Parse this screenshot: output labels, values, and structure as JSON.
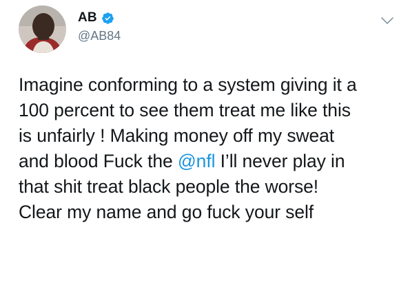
{
  "tweet": {
    "author": {
      "display_name": "AB",
      "handle": "@AB84",
      "verified": true,
      "avatar_icon": "profile-avatar-icon"
    },
    "menu_icon": "chevron-down-icon",
    "text_lines": [
      {
        "before": "Imagine conforming to a system giving it a",
        "mention": "",
        "after": ""
      },
      {
        "before": "100 percent to see them treat me like this",
        "mention": "",
        "after": ""
      },
      {
        "before": "is unfairly ! Making money off my sweat",
        "mention": "",
        "after": ""
      },
      {
        "before": "and blood Fuck the ",
        "mention": "@nfl",
        "after": " I’ll never play in"
      },
      {
        "before": "that shit treat black people the worse!",
        "mention": "",
        "after": ""
      },
      {
        "before": "Clear my name and go fuck your self",
        "mention": "",
        "after": ""
      }
    ]
  },
  "colors": {
    "text": "#14171a",
    "secondary": "#657786",
    "link": "#1b95e0",
    "verified": "#1da1f2"
  }
}
